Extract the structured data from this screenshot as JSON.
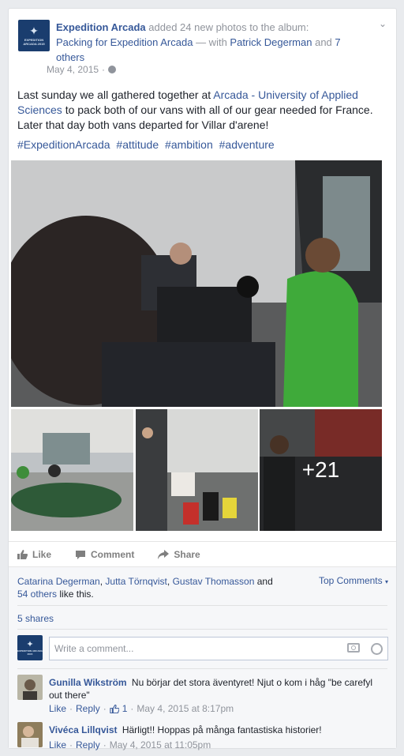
{
  "post": {
    "page_name": "Expedition Arcada",
    "action_text": "added 24 new photos to the album:",
    "album_name": "Packing for Expedition Arcada",
    "with_text": "— with",
    "tagged_person": "Patrick Degerman",
    "and_text": "and",
    "others_text": "7 others",
    "date": "May 4, 2015",
    "meta_sep": "·",
    "body_part1": "Last sunday we all gathered together at",
    "body_link": "Arcada - University of Applied Sciences",
    "body_part2": "to pack both of our vans with all of our gear needed for France. Later that day both vans departed for Villar d'arene!",
    "hashtags": [
      "#ExpeditionArcada",
      "#attitude",
      "#ambition",
      "#adventure"
    ],
    "more_photos": "+21",
    "avatar_label": "EXPEDITION ARCADA 2015"
  },
  "actions": {
    "like": "Like",
    "comment": "Comment",
    "share": "Share"
  },
  "reactions": {
    "names": [
      "Catarina Degerman",
      "Jutta Törnqvist",
      "Gustav Thomasson"
    ],
    "comma": ",",
    "and_text": "and",
    "others_link": "54 others",
    "tail": "like this.",
    "top_comments": "Top Comments",
    "shares": "5 shares"
  },
  "comment_input": {
    "placeholder": "Write a comment..."
  },
  "comments": [
    {
      "author": "Gunilla Wikström",
      "text": "Nu börjar det stora äventyret! Njut o kom i håg \"be carefyl out there\"",
      "like": "Like",
      "reply": "Reply",
      "like_count": "1",
      "time": "May 4, 2015 at 8:17pm"
    },
    {
      "author": "Vivéca Lillqvist",
      "text": "Härligt!! Hoppas på många fantastiska historier!",
      "like": "Like",
      "reply": "Reply",
      "time": "May 4, 2015 at 11:05pm"
    }
  ],
  "colors": {
    "link": "#365899",
    "muted": "#90949c",
    "page_bg": "#e9ebee",
    "avatar": "#1a3d6e"
  }
}
